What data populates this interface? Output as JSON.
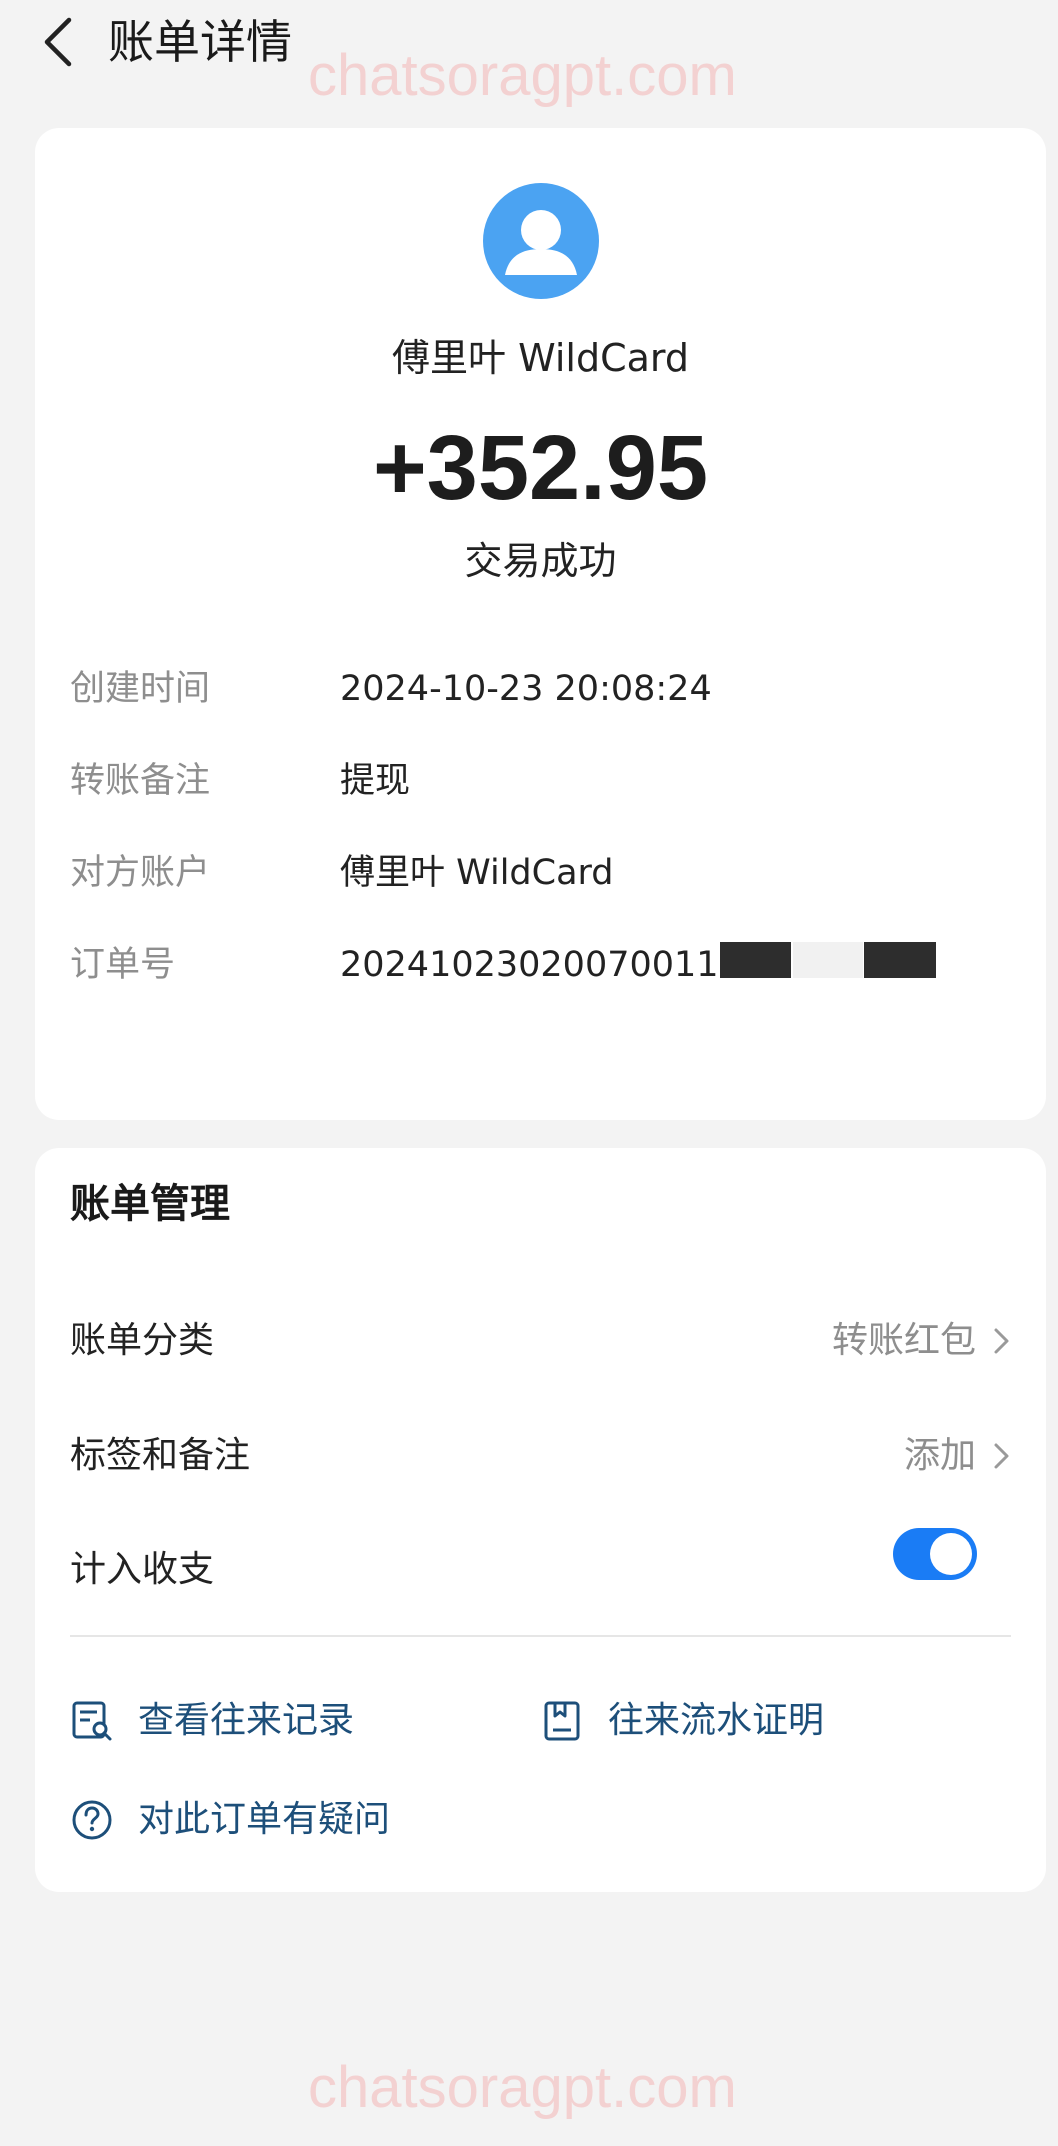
{
  "header": {
    "title": "账单详情",
    "back_icon": "chevron-left-icon"
  },
  "watermark": {
    "text": "chatsoragpt.com"
  },
  "transaction": {
    "avatar_icon": "user-avatar-icon",
    "payee": "傅里叶 WildCard",
    "amount": "+352.95",
    "status": "交易成功"
  },
  "details": [
    {
      "label": "创建时间",
      "value": "2024-10-23 20:08:24"
    },
    {
      "label": "转账备注",
      "value": "提现"
    },
    {
      "label": "对方账户",
      "value": "傅里叶 WildCard"
    },
    {
      "label": "订单号",
      "value": "20241023020070011579"
    }
  ],
  "manage": {
    "title": "账单管理",
    "rows": [
      {
        "label": "账单分类",
        "value": "转账红包"
      },
      {
        "label": "标签和备注",
        "value": "添加"
      },
      {
        "label": "计入收支",
        "toggle_on": true
      }
    ],
    "links": [
      {
        "label": "查看往来记录",
        "icon": "record-search-icon"
      },
      {
        "label": "往来流水证明",
        "icon": "document-icon"
      },
      {
        "label": "对此订单有疑问",
        "icon": "question-circle-icon"
      }
    ]
  },
  "colors": {
    "accent": "#1a7cf5",
    "avatar_bg": "#4ba3f2",
    "link_text": "#1d4f7a",
    "page_bg": "#f3f3f3",
    "watermark": "#f4c6c6"
  }
}
